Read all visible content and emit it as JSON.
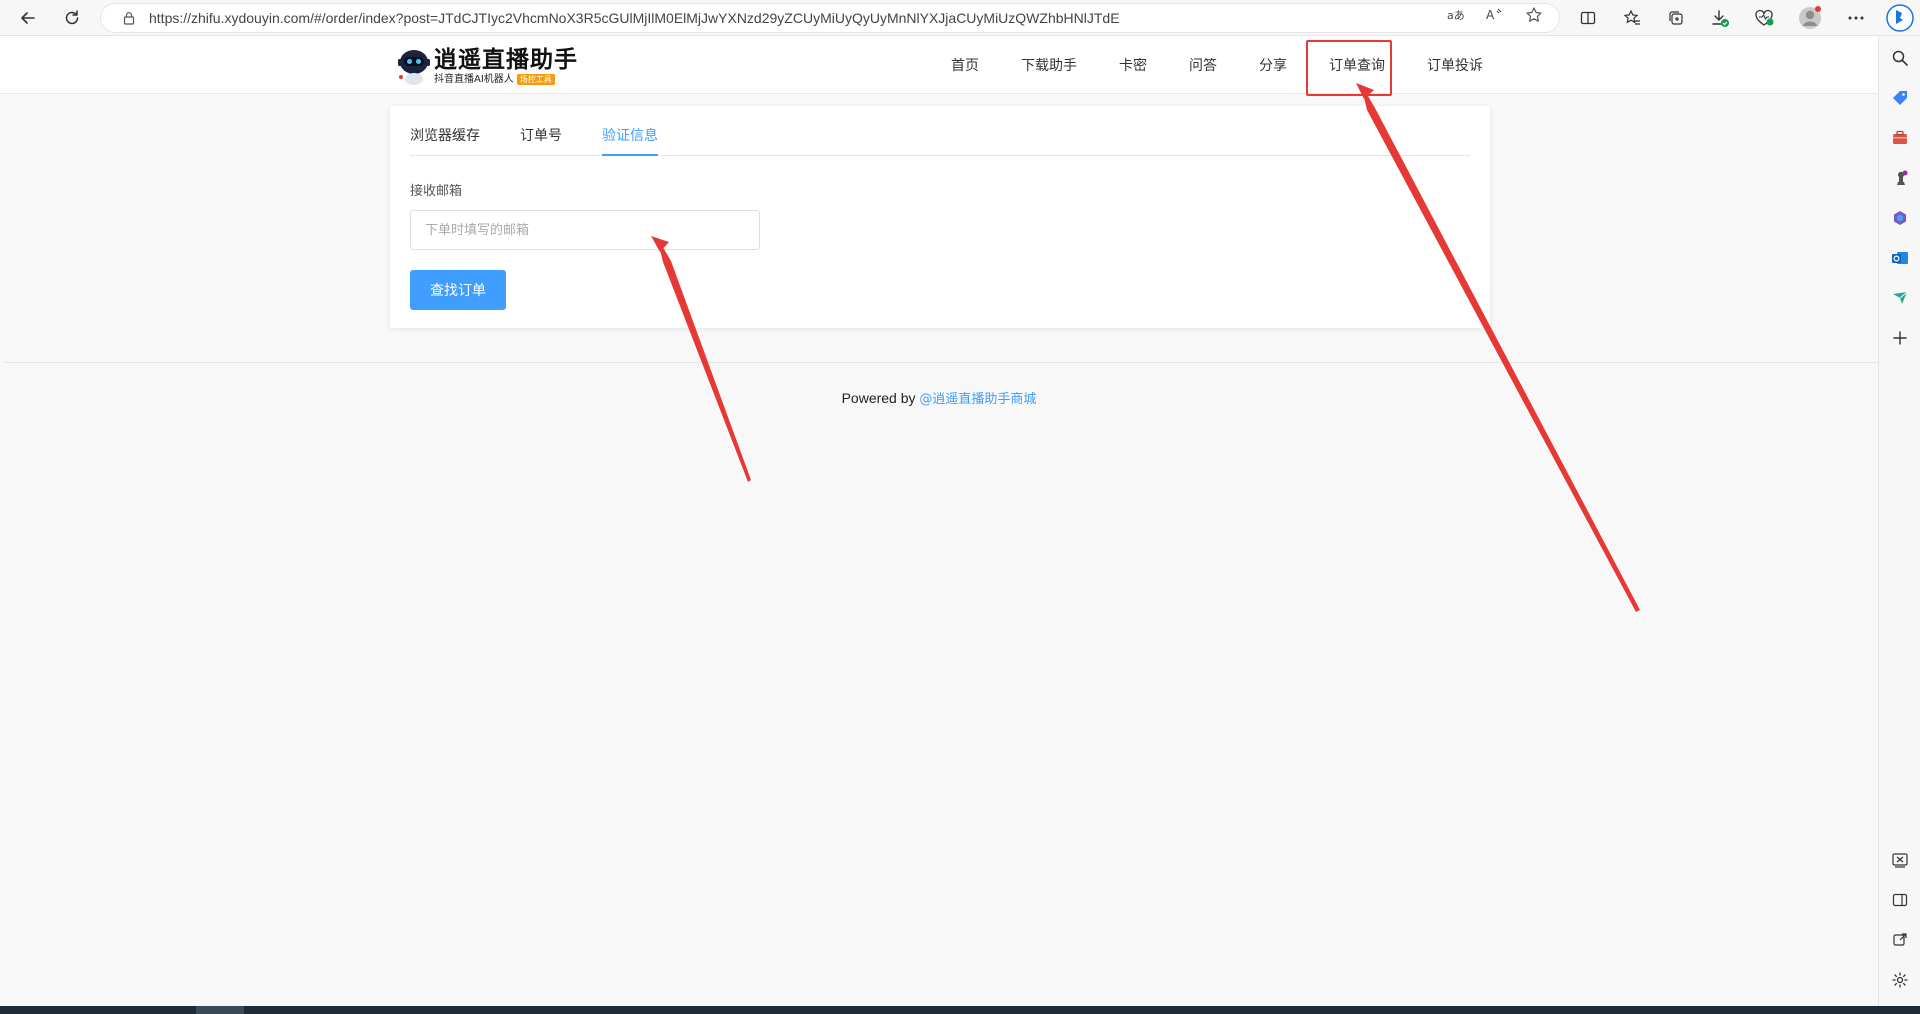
{
  "browser": {
    "url": "https://zhifu.xydouyin.com/#/order/index?post=JTdCJTIyc2VhcmNoX3R5cGUlMjIlM0ElMjJwYXNzd29yZCUyMiUyQyUyMnNlYXJjaCUyMiUzQWZhbHNlJTdE",
    "icons": [
      "back-icon",
      "refresh-icon",
      "lock-icon",
      "translate-icon",
      "read-aloud-icon",
      "favorite-star-icon",
      "split-screen-icon",
      "favorites-icon",
      "collections-icon",
      "downloads-icon",
      "health-icon",
      "profile-icon",
      "more-icon"
    ]
  },
  "edge_sidebar": {
    "icons": [
      "bing-copilot-icon",
      "search-icon",
      "shopping-tag-icon",
      "tools-briefcase-icon",
      "games-chess-icon",
      "microsoft365-icon",
      "outlook-icon",
      "send-icon",
      "add-icon",
      "screenshot-icon",
      "sidebar-toggle-icon",
      "external-link-icon",
      "settings-icon"
    ]
  },
  "header": {
    "logo_title": "逍遥直播助手",
    "logo_subtitle": "抖音直播AI机器人",
    "logo_badge": "场控工具",
    "nav": [
      {
        "label": "首页"
      },
      {
        "label": "下载助手"
      },
      {
        "label": "卡密"
      },
      {
        "label": "问答"
      },
      {
        "label": "分享"
      },
      {
        "label": "订单查询"
      },
      {
        "label": "订单投诉"
      }
    ]
  },
  "order_query": {
    "tabs": [
      {
        "label": "浏览器缓存",
        "active": false
      },
      {
        "label": "订单号",
        "active": false
      },
      {
        "label": "验证信息",
        "active": true
      }
    ],
    "email_label": "接收邮箱",
    "email_value": "",
    "email_placeholder": "下单时填写的邮箱",
    "submit_label": "查找订单"
  },
  "footer": {
    "powered_by": "Powered by",
    "link_text": "@逍遥直播助手商城"
  },
  "colors": {
    "accent": "#409eff",
    "annotation": "#e53935"
  }
}
